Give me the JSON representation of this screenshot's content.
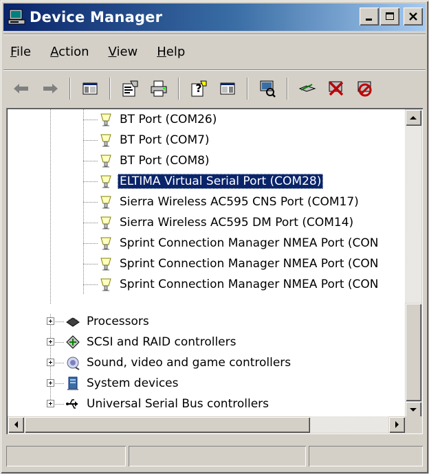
{
  "window": {
    "title": "Device Manager",
    "icon": "computer-icon",
    "controls": [
      "minimize-icon",
      "maximize-icon",
      "close-icon"
    ]
  },
  "menu": {
    "items": [
      {
        "accel": "F",
        "rest": "ile"
      },
      {
        "accel": "A",
        "rest": "ction"
      },
      {
        "accel": "V",
        "rest": "iew"
      },
      {
        "accel": "H",
        "rest": "elp"
      }
    ]
  },
  "toolbar": {
    "buttons": [
      "back-arrow-icon",
      "forward-arrow-icon",
      "show-hide-console-tree-icon",
      "properties-icon",
      "print-icon",
      "help-icon",
      "show-hide-action-pane-icon",
      "scan-hardware-changes-icon",
      "update-driver-icon",
      "uninstall-icon",
      "disable-device-icon"
    ]
  },
  "tree": {
    "ports": [
      {
        "label": "BT Port (COM26)"
      },
      {
        "label": "BT Port (COM7)"
      },
      {
        "label": "BT Port (COM8)"
      },
      {
        "label": "ELTIMA Virtual Serial Port (COM28)",
        "selected": true
      },
      {
        "label": "Sierra Wireless AC595 CNS Port (COM17)"
      },
      {
        "label": "Sierra Wireless AC595 DM Port (COM14)"
      },
      {
        "label": "Sprint Connection Manager NMEA Port (CON"
      },
      {
        "label": "Sprint Connection Manager NMEA Port (CON"
      },
      {
        "label": "Sprint Connection Manager NMEA Port (CON"
      }
    ],
    "categories": [
      {
        "label": "Processors",
        "icon": "processor-icon"
      },
      {
        "label": "SCSI and RAID controllers",
        "icon": "scsi-icon"
      },
      {
        "label": "Sound, video and game controllers",
        "icon": "speaker-icon"
      },
      {
        "label": "System devices",
        "icon": "system-device-icon"
      },
      {
        "label": "Universal Serial Bus controllers",
        "icon": "usb-icon"
      }
    ]
  },
  "colors": {
    "selection": "#0a246a",
    "window_face": "#d4d0c8",
    "title_gradient_start": "#0a246a",
    "title_gradient_end": "#a6caf0"
  },
  "statusbar": {
    "panes": [
      "",
      "",
      ""
    ]
  }
}
